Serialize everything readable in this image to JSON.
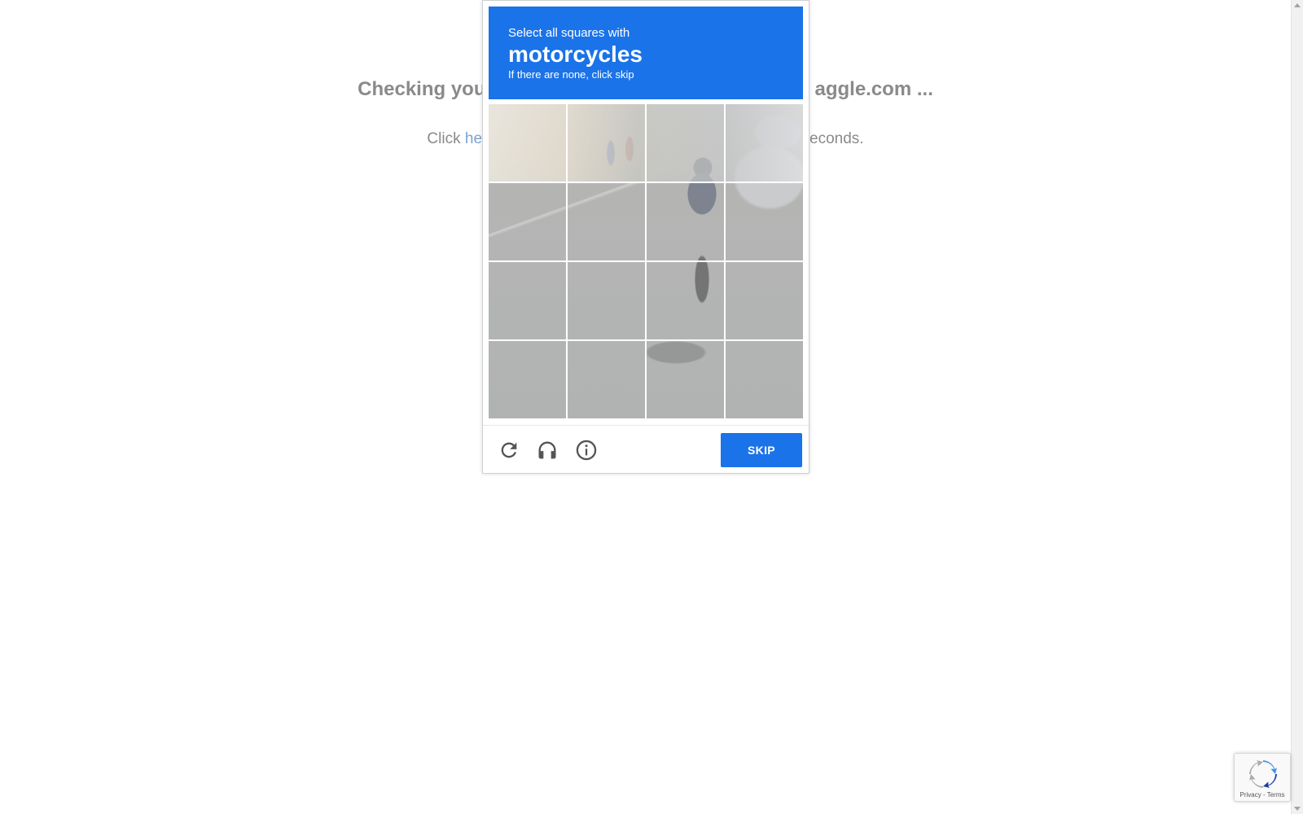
{
  "background_page": {
    "heading_left": "Checking you",
    "heading_right": "aggle.com ...",
    "sub_prefix": "Click ",
    "sub_link": "he",
    "sub_suffix": "econds."
  },
  "challenge": {
    "instruction_line1": "Select all squares with",
    "target_object": "motorcycles",
    "instruction_line3": "If there are none, click skip",
    "grid": {
      "rows": 4,
      "cols": 4
    },
    "footer": {
      "reload_icon": "reload-icon",
      "audio_icon": "headphones-icon",
      "info_icon": "info-icon",
      "skip_label": "SKIP"
    }
  },
  "badge": {
    "logo_icon": "recaptcha-logo",
    "links": "Privacy - Terms"
  },
  "colors": {
    "accent": "#1a73e8",
    "background_text": "#8a8a8a",
    "link": "#7ea2d6"
  }
}
